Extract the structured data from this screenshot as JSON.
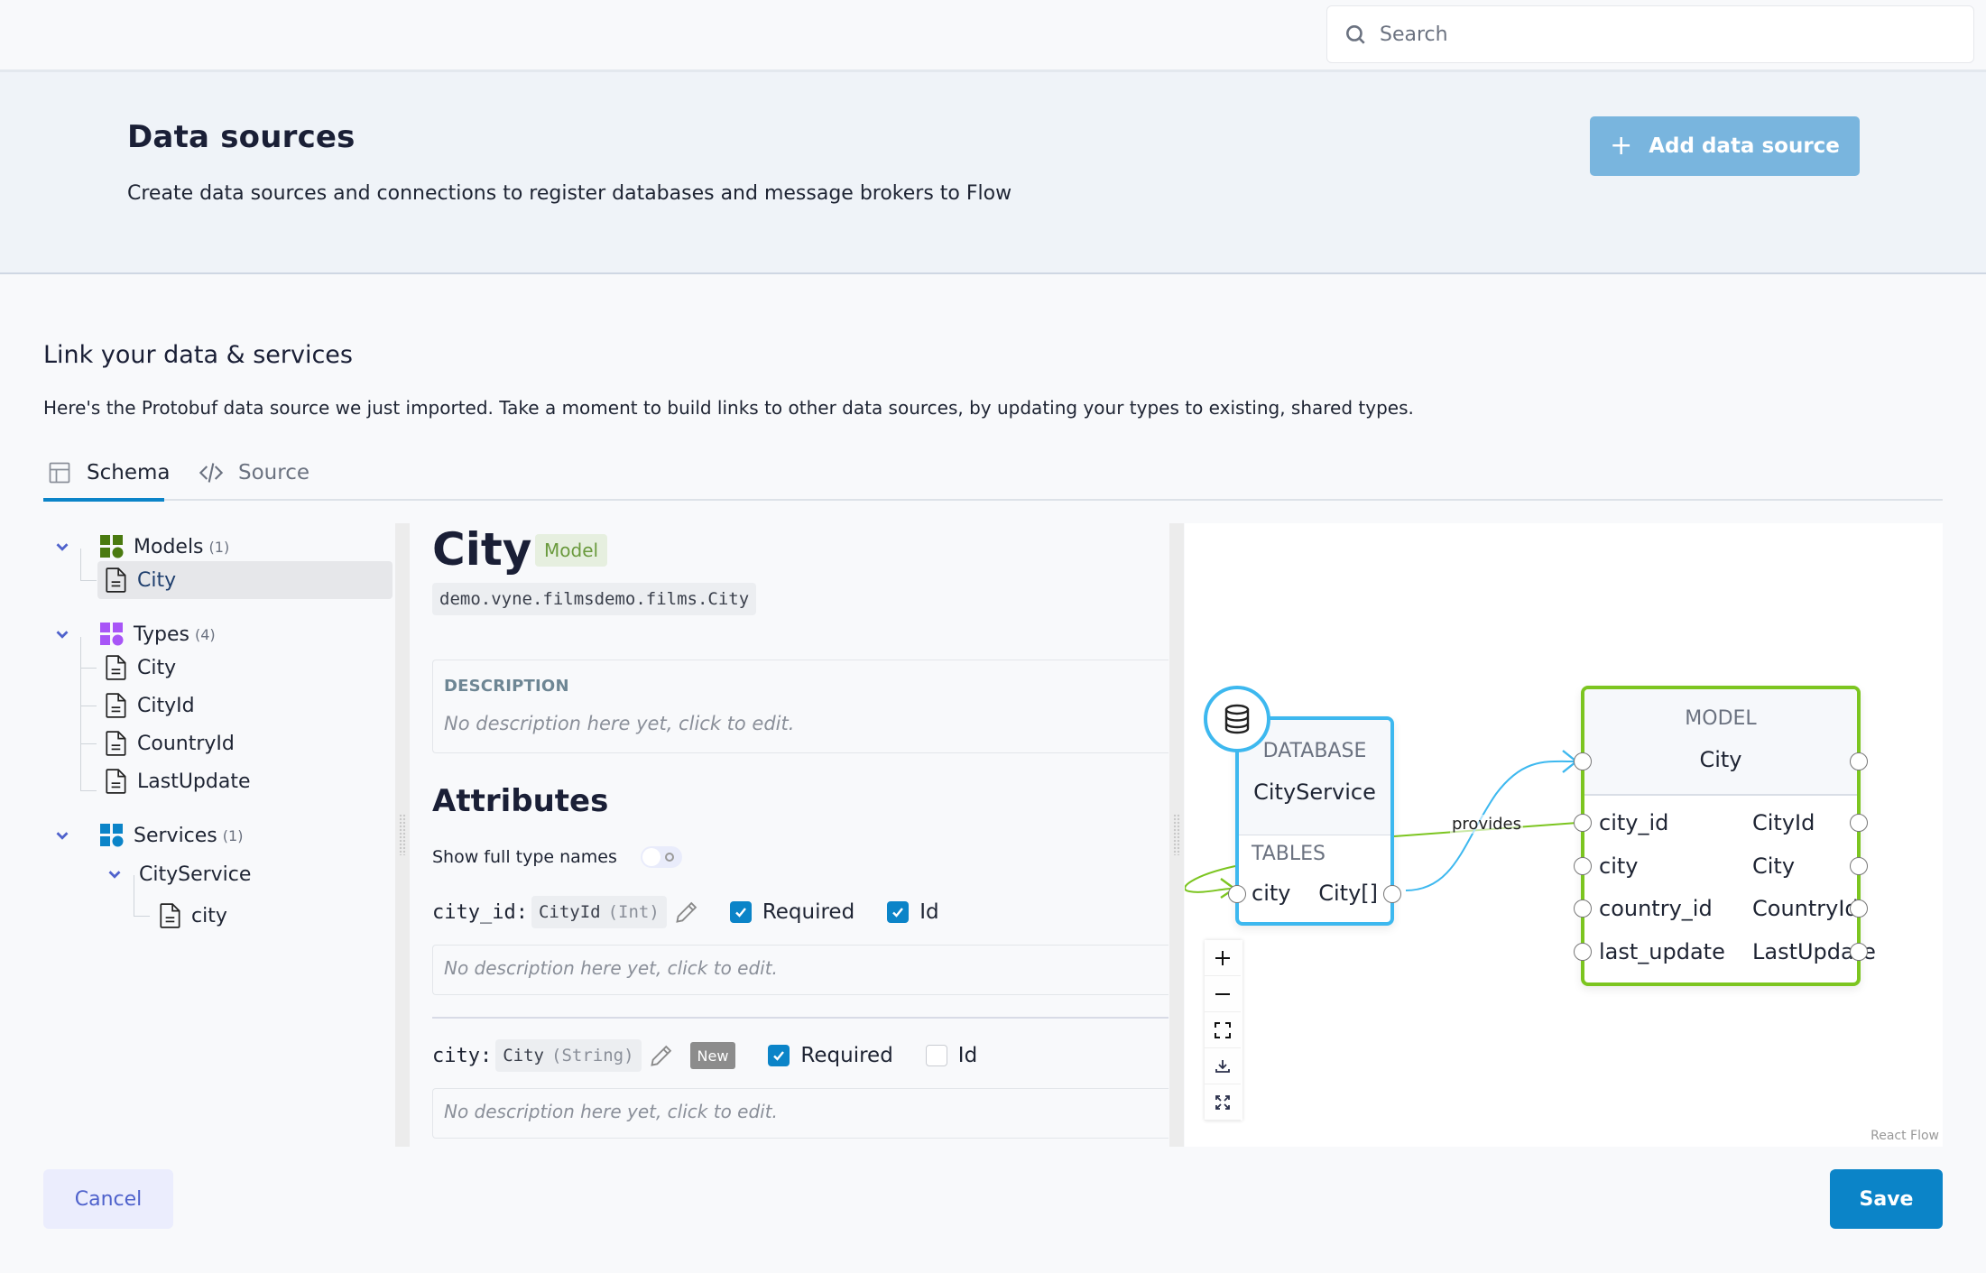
{
  "topbar": {
    "search": {
      "placeholder": "Search",
      "value": ""
    }
  },
  "header": {
    "title": "Data sources",
    "subtitle": "Create data sources and connections to register databases and message brokers to Flow",
    "add_button": "Add data source"
  },
  "section": {
    "title": "Link your data & services",
    "description": "Here's the Protobuf data source we just imported. Take a moment to build links to other data sources, by updating your types to existing, shared types."
  },
  "tabs": [
    {
      "label": "Schema",
      "icon": "table-icon",
      "active": true
    },
    {
      "label": "Source",
      "icon": "code-icon",
      "active": false
    }
  ],
  "tree": {
    "models": {
      "label": "Models",
      "count": "(1)",
      "color": "#4a7a10",
      "items": [
        "City"
      ]
    },
    "types": {
      "label": "Types",
      "count": "(4)",
      "color": "#a855f7",
      "items": [
        "City",
        "CityId",
        "CountryId",
        "LastUpdate"
      ]
    },
    "services": {
      "label": "Services",
      "count": "(1)",
      "color": "#0b84c8",
      "service": "CityService",
      "items": [
        "city"
      ]
    },
    "selected": "Models/City"
  },
  "detail": {
    "name": "City",
    "badge": "Model",
    "qualified_name": "demo.vyne.filmsdemo.films.City",
    "description_label": "DESCRIPTION",
    "description_placeholder": "No description here yet, click to edit.",
    "attributes_title": "Attributes",
    "show_full_type_names_label": "Show full type names",
    "show_full_type_names": false,
    "attributes": [
      {
        "name": "city_id:",
        "type": "CityId",
        "primitive": "(Int)",
        "new": false,
        "required": true,
        "id": true,
        "description_placeholder": "No description here yet, click to edit."
      },
      {
        "name": "city:",
        "type": "City",
        "primitive": "(String)",
        "new": true,
        "new_label": "New",
        "required": true,
        "id": false,
        "description_placeholder": "No description here yet, click to edit."
      }
    ],
    "required_label": "Required",
    "id_label": "Id"
  },
  "diagram": {
    "db_node": {
      "caption": "DATABASE",
      "name": "CityService",
      "section": "TABLES",
      "rows": [
        {
          "left": "city",
          "right": "City[]"
        }
      ],
      "border_color": "#3db8ef"
    },
    "model_node": {
      "caption": "MODEL",
      "name": "City",
      "border_color": "#7cc520",
      "rows": [
        {
          "field": "city_id",
          "type": "CityId"
        },
        {
          "field": "city",
          "type": "City"
        },
        {
          "field": "country_id",
          "type": "CountryId"
        },
        {
          "field": "last_update",
          "type": "LastUpdate"
        }
      ]
    },
    "edge_label": "provides",
    "attribution": "React Flow",
    "controls": [
      "zoom-in",
      "zoom-out",
      "fit-view",
      "download",
      "fullscreen"
    ]
  },
  "footer": {
    "cancel": "Cancel",
    "save": "Save"
  },
  "colors": {
    "primary": "#0b84c8",
    "add_button": "#79b5de",
    "model_green": "#7cc520",
    "db_blue": "#3db8ef"
  }
}
